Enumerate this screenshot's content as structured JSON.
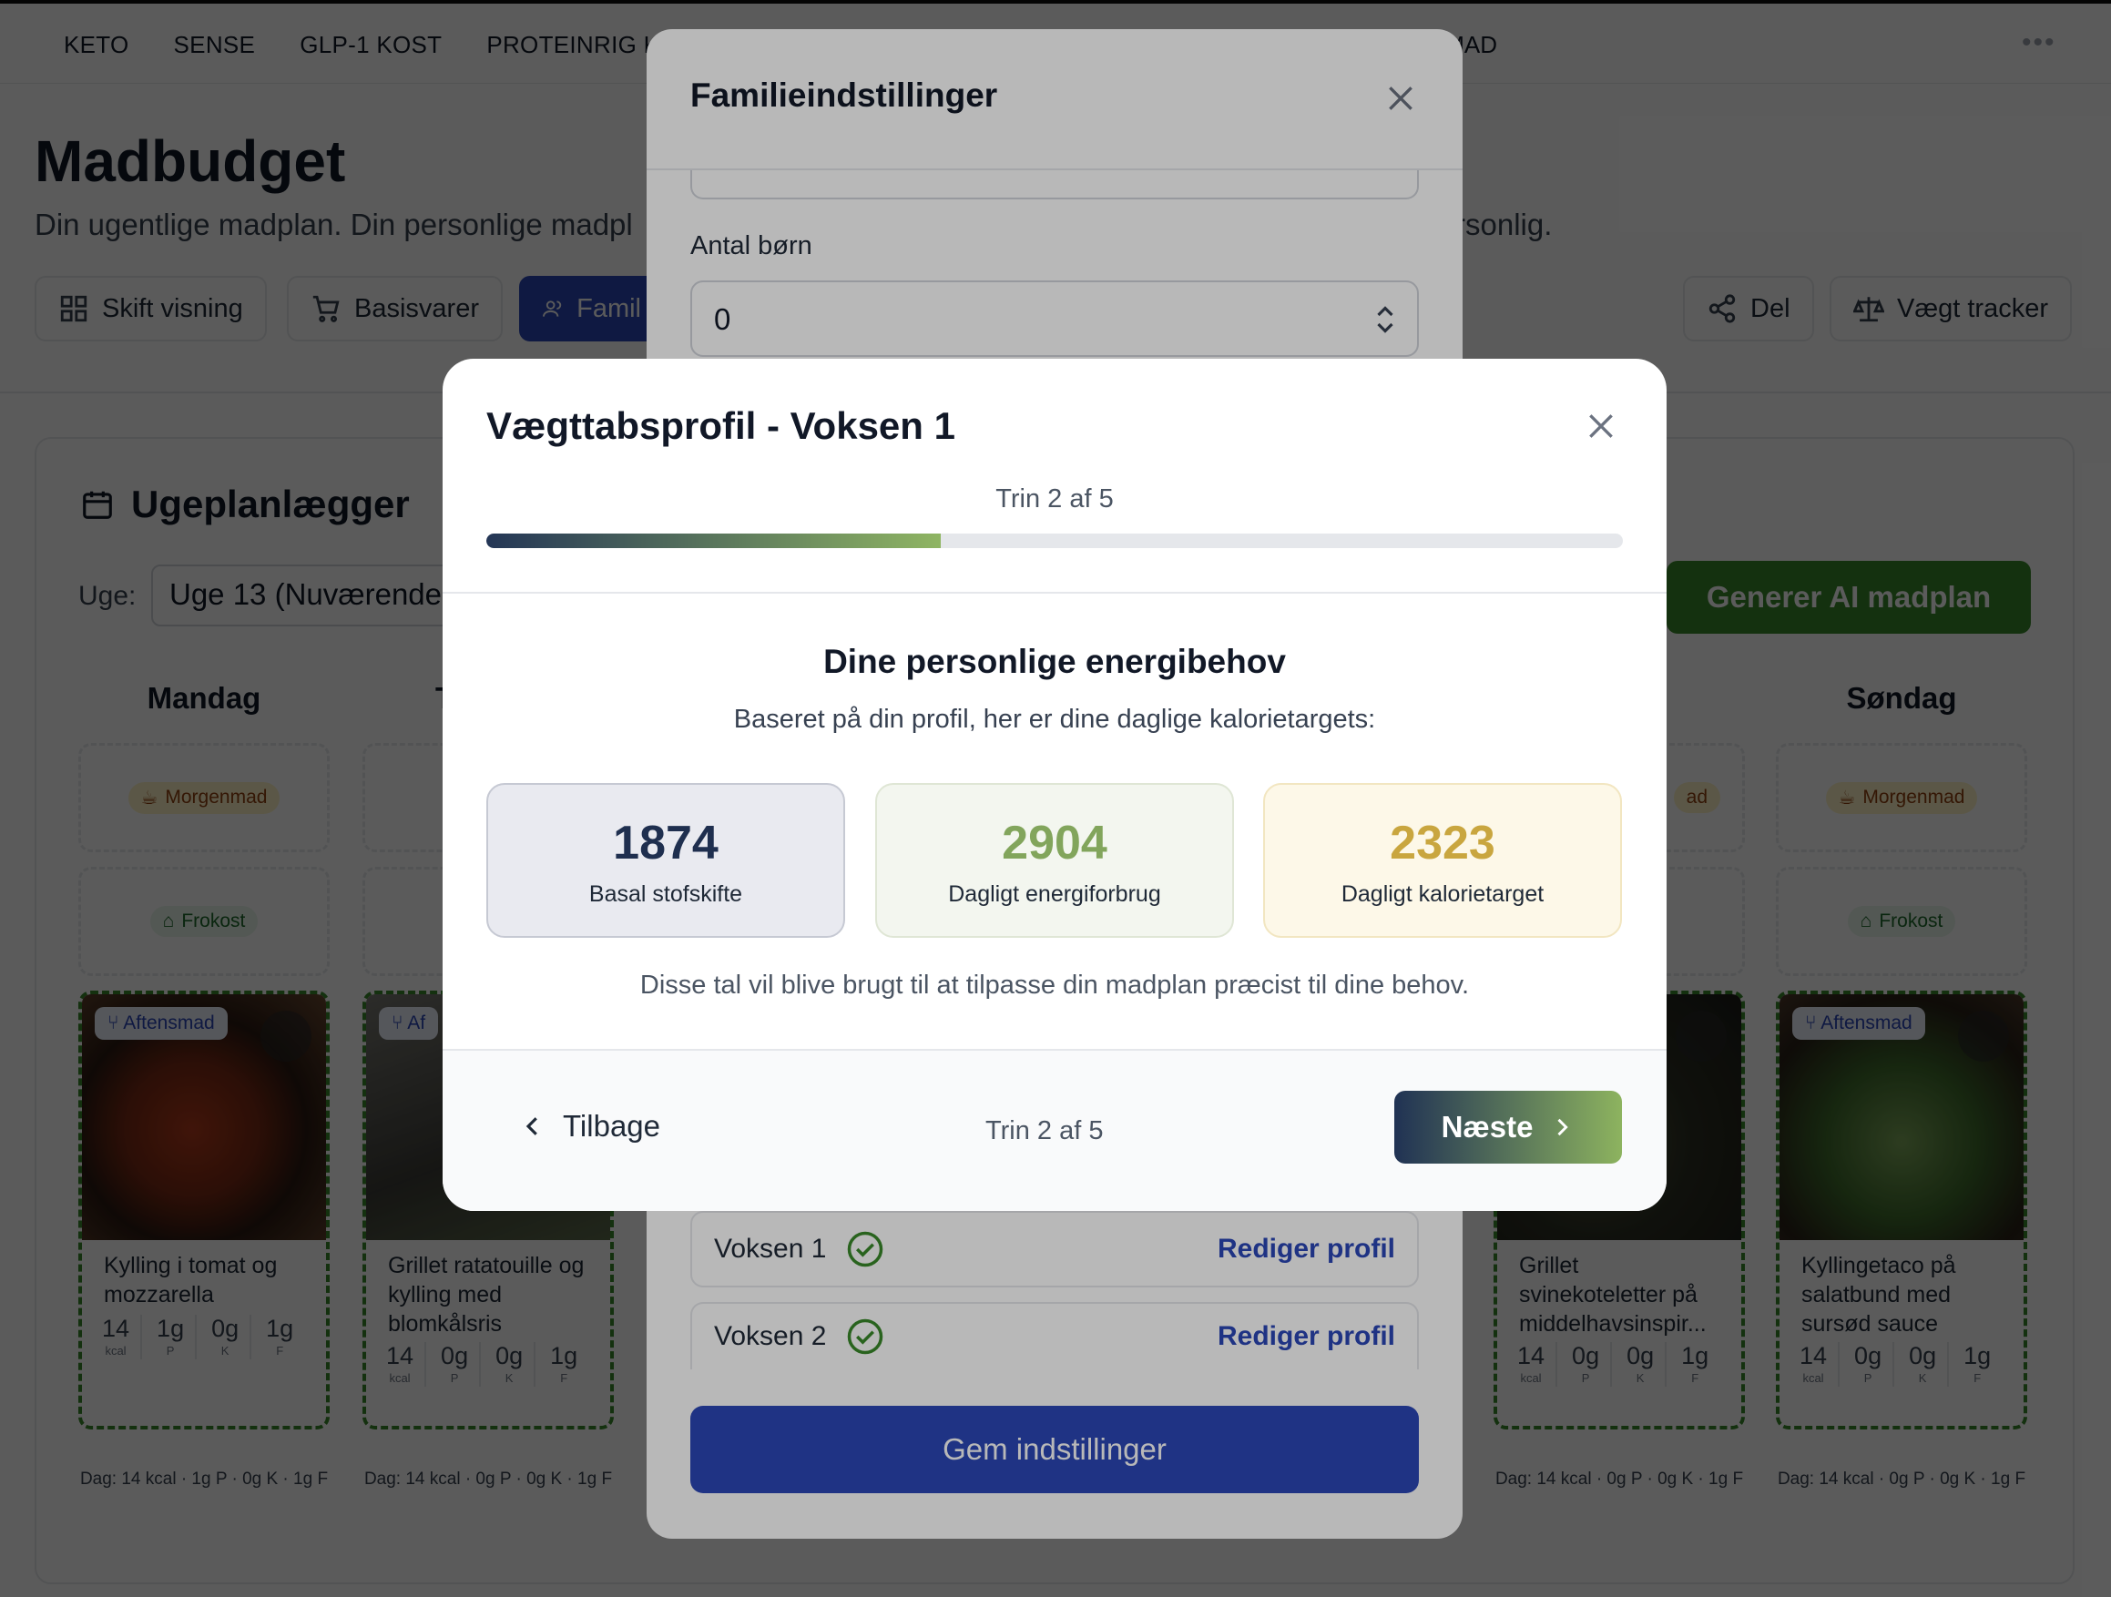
{
  "nav": {
    "items": [
      "KETO",
      "SENSE",
      "GLP-1 KOST",
      "PROTEINRIG KO"
    ],
    "right_item": "ILIEMAD",
    "more": "•••"
  },
  "page": {
    "title": "Madbudget",
    "subtitle_left": "Din ugentlige madplan. Din personlige madpl",
    "subtitle_right": "rsonlig."
  },
  "toolbar": {
    "view_label": "Skift visning",
    "basics_label": "Basisvarer",
    "family_label": "Famil",
    "share_label": "Del",
    "weight_label": "Vægt tracker"
  },
  "planner": {
    "title": "Ugeplanlægger",
    "week_label": "Uge:",
    "week_value": "Uge 13 (Nuværende",
    "generate_label": "Generer AI madplan",
    "days": [
      {
        "name": "Mandag",
        "breakfast": "Morgenmad",
        "lunch": "Frokost",
        "dinner_tag": "Aftensmad",
        "meal_title": "Kylling i tomat og mozzarella",
        "macros": [
          {
            "v": "14",
            "u": "kcal"
          },
          {
            "v": "1g",
            "u": "P"
          },
          {
            "v": "0g",
            "u": "K"
          },
          {
            "v": "1g",
            "u": "F"
          }
        ],
        "summary": "Dag: 14 kcal · 1g P · 0g K · 1g F"
      },
      {
        "name": "T",
        "breakfast": "",
        "lunch": "",
        "dinner_tag": "Af",
        "meal_title": "Grillet ratatouille og kylling med blomkålsris",
        "macros": [
          {
            "v": "14",
            "u": "kcal"
          },
          {
            "v": "0g",
            "u": "P"
          },
          {
            "v": "0g",
            "u": "K"
          },
          {
            "v": "1g",
            "u": "F"
          }
        ],
        "summary": "Dag: 14 kcal · 0g P · 0g K · 1g F"
      },
      {
        "name": "",
        "breakfast": "ad",
        "lunch": "",
        "dinner_tag": "",
        "meal_title": "Grillet svinekoteletter på middelhavsinspir...",
        "macros": [
          {
            "v": "14",
            "u": "kcal"
          },
          {
            "v": "0g",
            "u": "P"
          },
          {
            "v": "0g",
            "u": "K"
          },
          {
            "v": "1g",
            "u": "F"
          }
        ],
        "summary": "Dag: 14 kcal · 0g P · 0g K · 1g F"
      },
      {
        "name": "Søndag",
        "breakfast": "Morgenmad",
        "lunch": "Frokost",
        "dinner_tag": "Aftensmad",
        "meal_title": "Kyllingetaco på salatbund med sursød sauce",
        "macros": [
          {
            "v": "14",
            "u": "kcal"
          },
          {
            "v": "0g",
            "u": "P"
          },
          {
            "v": "0g",
            "u": "K"
          },
          {
            "v": "1g",
            "u": "F"
          }
        ],
        "summary": "Dag: 14 kcal · 0g P · 0g K · 1g F"
      }
    ]
  },
  "family_modal": {
    "title": "Familieindstillinger",
    "children_label": "Antal børn",
    "children_value": "0",
    "adults": [
      {
        "name": "Voksen 1",
        "edit_label": "Rediger profil"
      },
      {
        "name": "Voksen 2",
        "edit_label": "Rediger profil"
      }
    ],
    "save_label": "Gem indstillinger"
  },
  "profile_modal": {
    "title": "Vægttabsprofil - Voksen 1",
    "step_text": "Trin 2 af 5",
    "progress_fraction": 0.4,
    "section_title": "Dine personlige energibehov",
    "section_sub": "Baseret på din profil, her er dine daglige kalorietargets:",
    "stats": [
      {
        "value": "1874",
        "label": "Basal stofskifte"
      },
      {
        "value": "2904",
        "label": "Dagligt energiforbrug"
      },
      {
        "value": "2323",
        "label": "Dagligt kalorietarget"
      }
    ],
    "note": "Disse tal vil blive brugt til at tilpasse din madplan præcist til dine behov.",
    "back_label": "Tilbage",
    "footer_step": "Trin 2 af 5",
    "next_label": "Næste"
  }
}
